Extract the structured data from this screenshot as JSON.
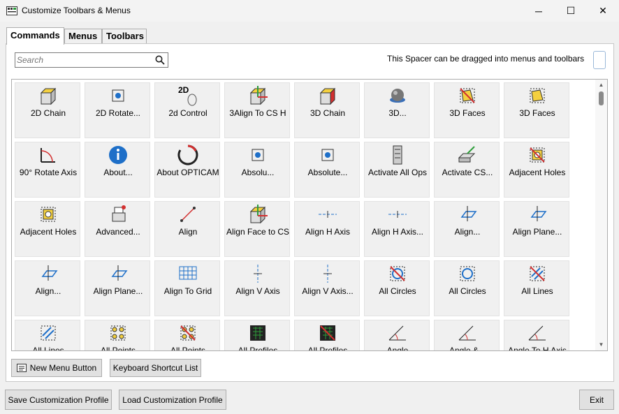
{
  "window": {
    "title": "Customize Toolbars & Menus",
    "minimize": "─",
    "maximize": "☐",
    "close": "✕"
  },
  "tabs": [
    {
      "label": "Commands"
    },
    {
      "label": "Menus"
    },
    {
      "label": "Toolbars"
    }
  ],
  "search": {
    "placeholder": "Search",
    "value": ""
  },
  "spacer": {
    "text": "This Spacer can be dragged into menus and toolbars"
  },
  "commands": [
    {
      "label": "2D Chain",
      "icon": "cube-chain-icon"
    },
    {
      "label": "2D Rotate...",
      "icon": "rotate-2d-icon"
    },
    {
      "label": "2d Control",
      "icon": "mouse-2d-icon"
    },
    {
      "label": "3Align To CS H",
      "icon": "align-cs-icon"
    },
    {
      "label": "3D Chain",
      "icon": "cube-red-icon"
    },
    {
      "label": "3D...",
      "icon": "sphere-3d-icon"
    },
    {
      "label": "3D Faces",
      "icon": "faces-crossed-icon"
    },
    {
      "label": "3D Faces",
      "icon": "faces-icon"
    },
    {
      "label": "90° Rotate Axis",
      "icon": "rotate-axis-icon"
    },
    {
      "label": "About...",
      "icon": "info-icon"
    },
    {
      "label": "About OPTICAM",
      "icon": "opticam-logo-icon"
    },
    {
      "label": "Absolu...",
      "icon": "absolute-rotate-icon"
    },
    {
      "label": "Absolute...",
      "icon": "absolute-icon"
    },
    {
      "label": "Activate All Ops",
      "icon": "activate-ops-icon"
    },
    {
      "label": "Activate CS...",
      "icon": "activate-cs-icon"
    },
    {
      "label": "Adjacent Holes",
      "icon": "adjacent-holes-icon"
    },
    {
      "label": "Adjacent Holes",
      "icon": "adjacent-holes-2-icon"
    },
    {
      "label": "Advanced...",
      "icon": "advanced-icon"
    },
    {
      "label": "Align",
      "icon": "align-icon"
    },
    {
      "label": "Align Face to CS",
      "icon": "align-face-icon"
    },
    {
      "label": "Align H Axis",
      "icon": "align-h-axis-icon"
    },
    {
      "label": "Align H Axis...",
      "icon": "align-h-axis-2-icon"
    },
    {
      "label": "Align...",
      "icon": "align-plane-icon"
    },
    {
      "label": "Align Plane...",
      "icon": "align-plane-2-icon"
    },
    {
      "label": "Align...",
      "icon": "align-parallelogram-icon"
    },
    {
      "label": "Align Plane...",
      "icon": "align-plane-3-icon"
    },
    {
      "label": "Align To Grid",
      "icon": "align-grid-icon"
    },
    {
      "label": "Align V Axis",
      "icon": "align-v-axis-icon"
    },
    {
      "label": "Align V Axis...",
      "icon": "align-v-axis-2-icon"
    },
    {
      "label": "All Circles",
      "icon": "all-circles-crossed-icon"
    },
    {
      "label": "All Circles",
      "icon": "all-circles-icon"
    },
    {
      "label": "All Lines",
      "icon": "all-lines-icon"
    },
    {
      "label": "All Lines",
      "icon": "all-lines-2-icon"
    },
    {
      "label": "All Points",
      "icon": "all-points-icon"
    },
    {
      "label": "All Points",
      "icon": "all-points-crossed-icon"
    },
    {
      "label": "All Profiles",
      "icon": "all-profiles-icon"
    },
    {
      "label": "All Profiles",
      "icon": "all-profiles-crossed-icon"
    },
    {
      "label": "Angle",
      "icon": "angle-icon"
    },
    {
      "label": "Angle &...",
      "icon": "angle-and-icon"
    },
    {
      "label": "Angle To H Axis",
      "icon": "angle-h-axis-icon"
    }
  ],
  "buttons": {
    "new_menu": "New Menu Button",
    "shortcut": "Keyboard Shortcut List",
    "save_profile": "Save Customization Profile",
    "load_profile": "Load Customization Profile",
    "exit": "Exit"
  }
}
